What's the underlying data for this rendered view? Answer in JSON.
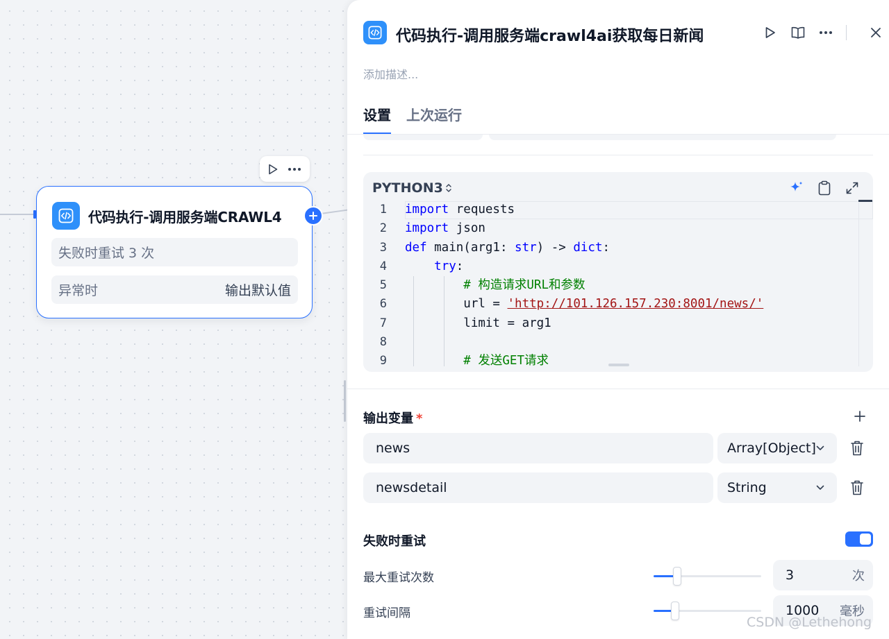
{
  "canvas": {
    "node": {
      "title": "代码执行-调用服务端CRAWL4",
      "retry_text": "失败时重试 3 次",
      "error_label": "异常时",
      "error_value": "输出默认值"
    }
  },
  "panel": {
    "title": "代码执行-调用服务端crawl4ai获取每日新闻",
    "description_placeholder": "添加描述...",
    "tabs": [
      {
        "label": "设置",
        "active": true
      },
      {
        "label": "上次运行",
        "active": false
      }
    ],
    "code": {
      "language": "PYTHON3",
      "line_numbers": [
        "1",
        "2",
        "3",
        "4",
        "5",
        "6",
        "7",
        "8",
        "9"
      ]
    },
    "outputs": {
      "title": "输出变量",
      "required_mark": "*",
      "variables": [
        {
          "name": "news",
          "type": "Array[Object]"
        },
        {
          "name": "newsdetail",
          "type": "String"
        }
      ]
    },
    "retry": {
      "title": "失败时重试",
      "enabled": true,
      "max_retries_label": "最大重试次数",
      "max_retries_value": "3",
      "max_retries_unit": "次",
      "max_retries_slider_fraction": 0.22,
      "interval_label": "重试间隔",
      "interval_value": "1000",
      "interval_unit": "毫秒",
      "interval_slider_fraction": 0.2
    }
  },
  "watermark": "CSDN @Lethehong",
  "colors": {
    "accent": "#2970ff",
    "icon_bg": "#2e90fa"
  }
}
